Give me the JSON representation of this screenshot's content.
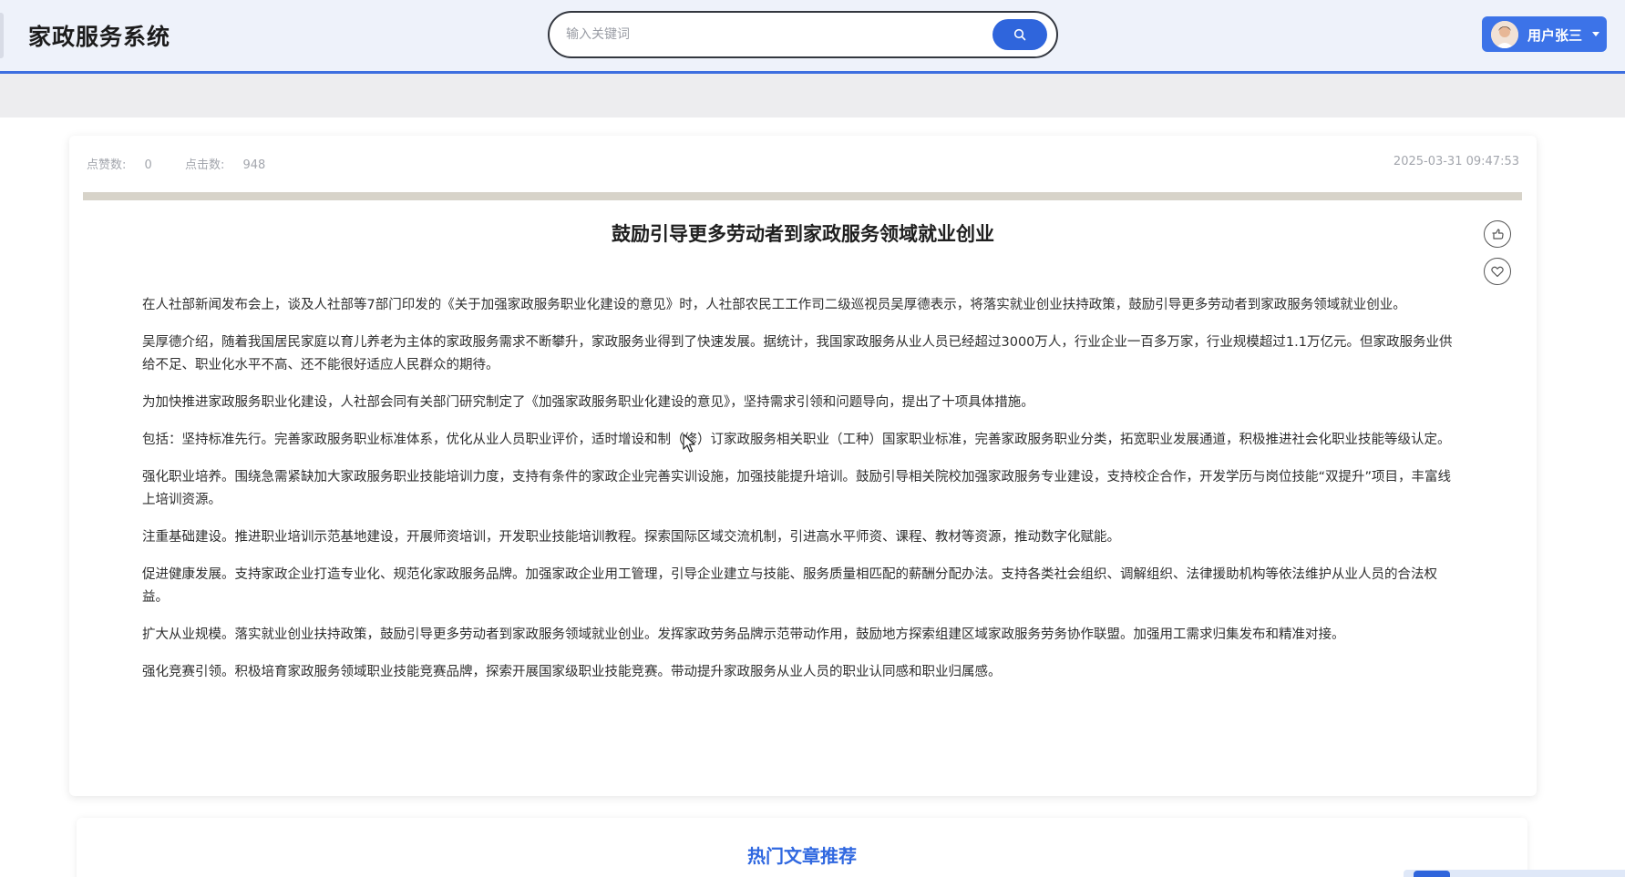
{
  "header": {
    "app_title": "家政服务系统",
    "search": {
      "placeholder": "输入关键词",
      "value": ""
    },
    "user": {
      "name": "用户张三"
    }
  },
  "article": {
    "likes_label": "点赞数:",
    "likes": "0",
    "clicks_label": "点击数:",
    "clicks": "948",
    "datetime": "2025-03-31 09:47:53",
    "title": "鼓励引导更多劳动者到家政服务领域就业创业",
    "paragraphs": [
      "在人社部新闻发布会上，谈及人社部等7部门印发的《关于加强家政服务职业化建设的意见》时，人社部农民工工作司二级巡视员吴厚德表示，将落实就业创业扶持政策，鼓励引导更多劳动者到家政服务领域就业创业。",
      "吴厚德介绍，随着我国居民家庭以育儿养老为主体的家政服务需求不断攀升，家政服务业得到了快速发展。据统计，我国家政服务从业人员已经超过3000万人，行业企业一百多万家，行业规模超过1.1万亿元。但家政服务业供给不足、职业化水平不高、还不能很好适应人民群众的期待。",
      "为加快推进家政服务职业化建设，人社部会同有关部门研究制定了《加强家政服务职业化建设的意见》，坚持需求引领和问题导向，提出了十项具体措施。",
      "包括：坚持标准先行。完善家政服务职业标准体系，优化从业人员职业评价，适时增设和制（修）订家政服务相关职业（工种）国家职业标准，完善家政服务职业分类，拓宽职业发展通道，积极推进社会化职业技能等级认定。",
      "强化职业培养。围绕急需紧缺加大家政服务职业技能培训力度，支持有条件的家政企业完善实训设施，加强技能提升培训。鼓励引导相关院校加强家政服务专业建设，支持校企合作，开发学历与岗位技能“双提升”项目，丰富线上培训资源。",
      "注重基础建设。推进职业培训示范基地建设，开展师资培训，开发职业技能培训教程。探索国际区域交流机制，引进高水平师资、课程、教材等资源，推动数字化赋能。",
      "促进健康发展。支持家政企业打造专业化、规范化家政服务品牌。加强家政企业用工管理，引导企业建立与技能、服务质量相匹配的薪酬分配办法。支持各类社会组织、调解组织、法律援助机构等依法维护从业人员的合法权益。",
      "扩大从业规模。落实就业创业扶持政策，鼓励引导更多劳动者到家政服务领域就业创业。发挥家政劳务品牌示范带动作用，鼓励地方探索组建区域家政服务劳务协作联盟。加强用工需求归集发布和精准对接。",
      "强化竞赛引领。积极培育家政服务领域职业技能竞赛品牌，探索开展国家级职业技能竞赛。带动提升家政服务从业人员的职业认同感和职业归属感。"
    ]
  },
  "hot": {
    "title": "热门文章推荐"
  },
  "colors": {
    "accent": "#2f65dc",
    "header_bg": "#eef2fa",
    "hot_title": "#3068e0"
  },
  "icons": [
    "search-icon",
    "avatar",
    "chevron-down-icon",
    "thumbs-up-icon",
    "heart-icon",
    "mouse-cursor-icon"
  ]
}
